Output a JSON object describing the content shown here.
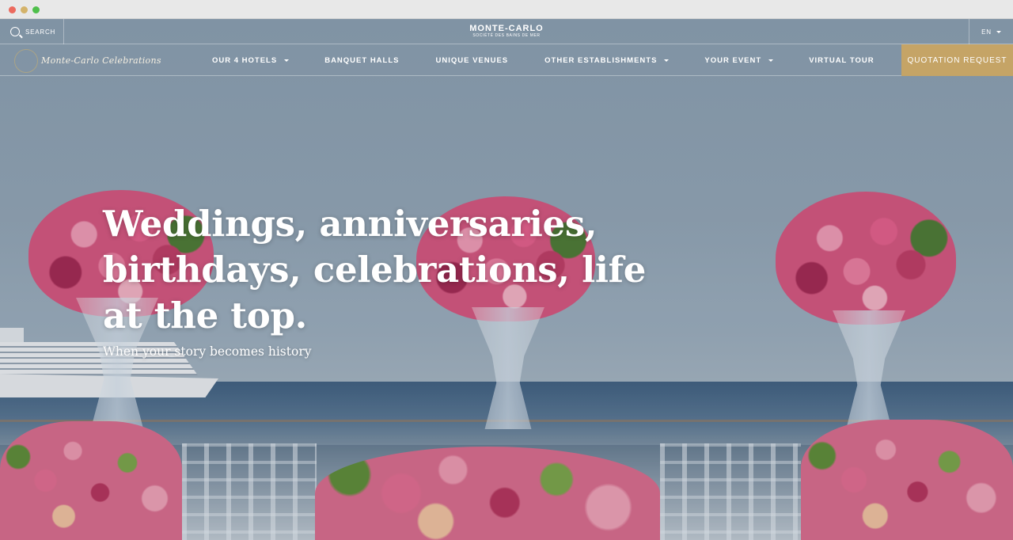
{
  "header": {
    "search_label": "SEARCH",
    "brand_name": "MONTE-CARLO",
    "brand_subtitle": "SOCIÉTÉ DES BAINS DE MER",
    "language": "EN"
  },
  "nav": {
    "logo_text": "Monte-Carlo Celebrations",
    "items": [
      {
        "label": "OUR 4 HOTELS",
        "dropdown": true
      },
      {
        "label": "BANQUET HALLS",
        "dropdown": false
      },
      {
        "label": "UNIQUE VENUES",
        "dropdown": false
      },
      {
        "label": "OTHER ESTABLISHMENTS",
        "dropdown": true
      },
      {
        "label": "YOUR EVENT",
        "dropdown": true
      },
      {
        "label": "VIRTUAL TOUR",
        "dropdown": false
      }
    ],
    "cta_label": "QUOTATION REQUEST",
    "cta_color": "#c5a466"
  },
  "hero": {
    "headline": "Weddings, anniversaries, birthdays, celebrations, life at the top.",
    "subline": "When your story becomes history"
  }
}
